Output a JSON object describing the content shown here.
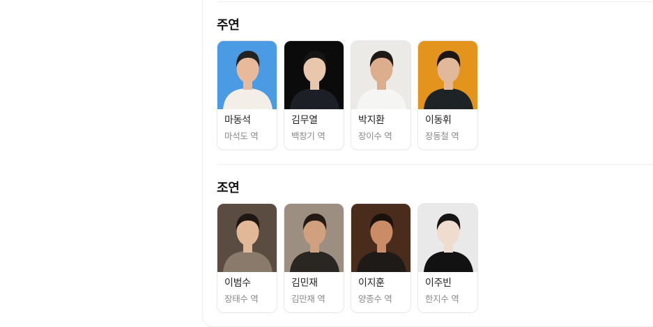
{
  "main_cast": {
    "title": "주연",
    "members": [
      {
        "name": "마동석",
        "role": "마석도 역",
        "bg": "#4a9be3",
        "skin": "#e8b99a",
        "hair": "#222",
        "cloth": "#f3efe8"
      },
      {
        "name": "김무열",
        "role": "백창기 역",
        "bg": "#0b0b0b",
        "skin": "#e8c7ad",
        "hair": "#151515",
        "cloth": "#1c1f26"
      },
      {
        "name": "박지환",
        "role": "장이수 역",
        "bg": "#eceae6",
        "skin": "#dcae8e",
        "hair": "#1f1a16",
        "cloth": "#f5f5f3"
      },
      {
        "name": "이동휘",
        "role": "장동철 역",
        "bg": "#e3941c",
        "skin": "#e2b89a",
        "hair": "#1d1612",
        "cloth": "#1e2426"
      }
    ]
  },
  "supporting_cast": {
    "title": "조연",
    "members": [
      {
        "name": "이범수",
        "role": "장태수 역",
        "bg": "#5a4c40",
        "skin": "#e1b898",
        "hair": "#1e1712",
        "cloth": "#8a7a6c"
      },
      {
        "name": "김민재",
        "role": "김만재 역",
        "bg": "#9c8e80",
        "skin": "#d1a07e",
        "hair": "#241a14",
        "cloth": "#2a2622"
      },
      {
        "name": "이지훈",
        "role": "양종수 역",
        "bg": "#4a2c1c",
        "skin": "#c98c66",
        "hair": "#1a120c",
        "cloth": "#1d1a18"
      },
      {
        "name": "이주빈",
        "role": "한지수 역",
        "bg": "#e9e9e9",
        "skin": "#f0dccf",
        "hair": "#161616",
        "cloth": "#121212"
      }
    ]
  }
}
